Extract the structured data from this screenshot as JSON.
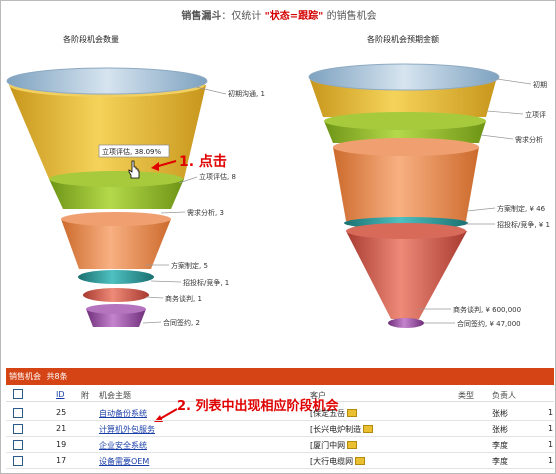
{
  "header": {
    "prefix": "销售漏斗",
    "mid": "：仅统计 ",
    "status": "\"状态=跟踪\"",
    "suffix": " 的销售机会"
  },
  "charts": {
    "left_title": "各阶段机会数量",
    "right_title": "各阶段机会预期金额"
  },
  "chart_data": [
    {
      "type": "funnel",
      "title": "各阶段机会数量",
      "categories": [
        "初期沟通",
        "立项评估",
        "需求分析",
        "方案制定",
        "招投标/竞争",
        "商务谈判",
        "合同签约"
      ],
      "values": [
        1,
        8,
        3,
        5,
        1,
        1,
        2
      ],
      "labels": [
        "初期沟通, 1",
        "立项评估, 8",
        "需求分析, 3",
        "方案制定, 5",
        "招投标/竞争, 1",
        "商务谈判, 1",
        "合同签约, 2"
      ],
      "tooltip": "立项评估, 38.09%",
      "colors": [
        "#a9c5dc",
        "#e3b82a",
        "#8cb32c",
        "#ec8d4f",
        "#2a9a9a",
        "#cd5a4a",
        "#9a4fa0"
      ]
    },
    {
      "type": "funnel",
      "title": "各阶段机会预期金额",
      "categories": [
        "初期",
        "立项评",
        "需求分析",
        "方案制定",
        "招投标/竞争",
        "商务谈判",
        "合同签约"
      ],
      "labels": [
        "初期",
        "立项评",
        "需求分析",
        "方案制定, ¥ 46",
        "招投标/竞争, ¥ 1",
        "商务谈判, ¥ 600,000",
        "合同签约, ¥ 47,000"
      ],
      "values_visible": {
        "商务谈判": 600000,
        "合同签约": 47000
      },
      "colors": [
        "#a9c5dc",
        "#e3b82a",
        "#8cb32c",
        "#ec8d4f",
        "#2a9a9a",
        "#cd5a4a",
        "#9a4fa0"
      ]
    }
  ],
  "annotations": {
    "click": "1. 点击",
    "list": "2. 列表中出现相应阶段机会"
  },
  "panel": {
    "title": "销售机会",
    "count": "共8条"
  },
  "table": {
    "columns": {
      "id": "ID",
      "attach": "附",
      "subject": "机会主题",
      "customer": "客户",
      "type": "类型",
      "owner": "负责人"
    },
    "rows": [
      {
        "id": "25",
        "subject": "自动备份系统",
        "customer": "[保定五岳",
        "owner": "张彬",
        "extra": "1"
      },
      {
        "id": "21",
        "subject": "计算机外包服务",
        "customer": "[长兴电炉制造",
        "owner": "张彬",
        "extra": "1"
      },
      {
        "id": "19",
        "subject": "企业安全系统",
        "customer": "[厦门中网",
        "owner": "李度",
        "extra": "1"
      },
      {
        "id": "17",
        "subject": "设备需要OEM",
        "customer": "[大行电缆网",
        "owner": "李度",
        "extra": "1"
      }
    ]
  }
}
